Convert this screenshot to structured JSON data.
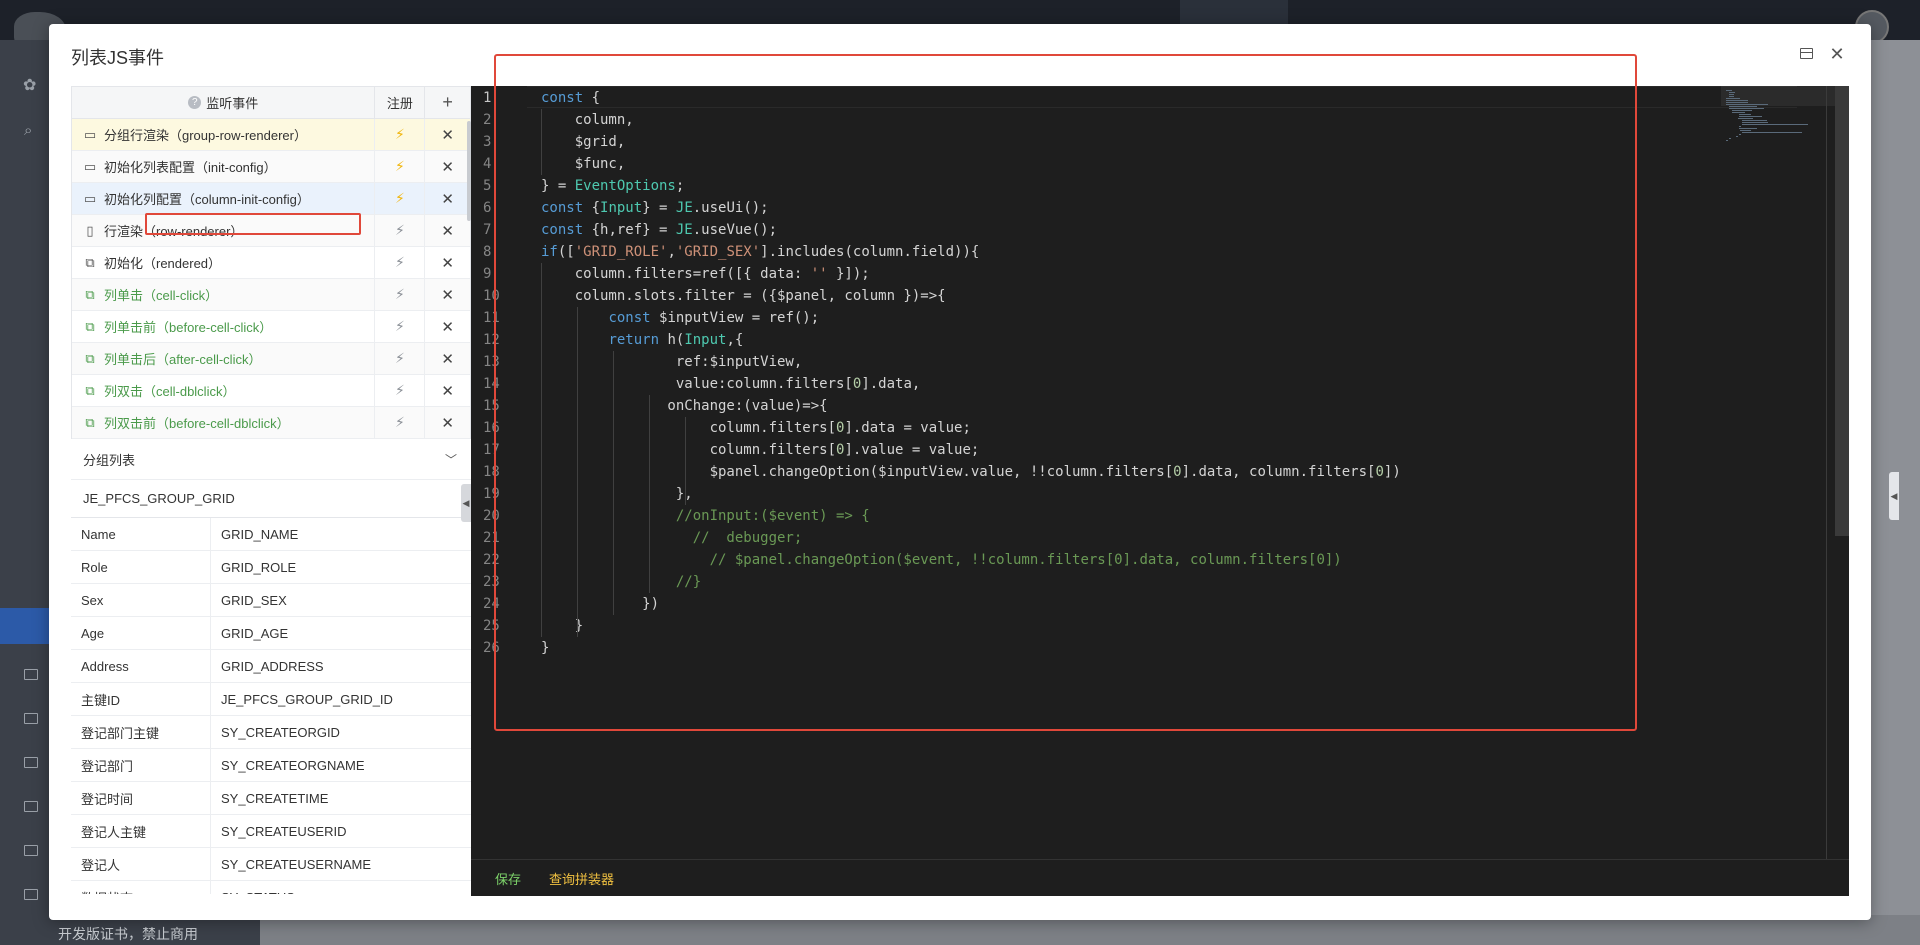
{
  "dialog": {
    "title": "列表JS事件"
  },
  "events": {
    "header": {
      "listen": "监听事件",
      "register": "注册",
      "add": "+"
    },
    "rows": [
      {
        "label": "分组行渲染（group-row-renderer）",
        "icon": "laptop-icon",
        "green": false,
        "registered": true
      },
      {
        "label": "初始化列表配置（init-config）",
        "icon": "laptop-icon",
        "green": false,
        "registered": true
      },
      {
        "label": "初始化列配置（column-init-config）",
        "icon": "laptop-icon",
        "green": false,
        "registered": true
      },
      {
        "label": "行渲染（row-renderer）",
        "icon": "mobile-icon",
        "green": false,
        "registered": false
      },
      {
        "label": "初始化（rendered）",
        "icon": "devices-icon",
        "green": false,
        "registered": false
      },
      {
        "label": "列单击（cell-click）",
        "icon": "devices-icon",
        "green": true,
        "registered": false
      },
      {
        "label": "列单击前（before-cell-click）",
        "icon": "devices-icon",
        "green": true,
        "registered": false
      },
      {
        "label": "列单击后（after-cell-click）",
        "icon": "devices-icon",
        "green": true,
        "registered": false
      },
      {
        "label": "列双击（cell-dblclick）",
        "icon": "devices-icon",
        "green": true,
        "registered": false
      },
      {
        "label": "列双击前（before-cell-dblclick）",
        "icon": "devices-icon",
        "green": true,
        "registered": false
      }
    ]
  },
  "group": {
    "title": "分组列表",
    "code": "JE_PFCS_GROUP_GRID",
    "fields": [
      {
        "name": "Name",
        "code": "GRID_NAME"
      },
      {
        "name": "Role",
        "code": "GRID_ROLE"
      },
      {
        "name": "Sex",
        "code": "GRID_SEX"
      },
      {
        "name": "Age",
        "code": "GRID_AGE"
      },
      {
        "name": "Address",
        "code": "GRID_ADDRESS"
      },
      {
        "name": "主键ID",
        "code": "JE_PFCS_GROUP_GRID_ID"
      },
      {
        "name": "登记部门主键",
        "code": "SY_CREATEORGID"
      },
      {
        "name": "登记部门",
        "code": "SY_CREATEORGNAME"
      },
      {
        "name": "登记时间",
        "code": "SY_CREATETIME"
      },
      {
        "name": "登记人主键",
        "code": "SY_CREATEUSERID"
      },
      {
        "name": "登记人",
        "code": "SY_CREATEUSERNAME"
      },
      {
        "name": "数据状态",
        "code": "SY_STATUS"
      }
    ]
  },
  "editor": {
    "lines": [
      [
        [
          "kw",
          "const"
        ],
        [
          "p",
          " {"
        ]
      ],
      [
        [
          "p",
          "    column,"
        ]
      ],
      [
        [
          "p",
          "    $grid,"
        ]
      ],
      [
        [
          "p",
          "    $func,"
        ]
      ],
      [
        [
          "p",
          "} = "
        ],
        [
          "cls",
          "EventOptions"
        ],
        [
          "p",
          ";"
        ]
      ],
      [
        [
          "kw",
          "const"
        ],
        [
          "p",
          " {"
        ],
        [
          "cls",
          "Input"
        ],
        [
          "p",
          "} = "
        ],
        [
          "cls",
          "JE"
        ],
        [
          "p",
          ".useUi();"
        ]
      ],
      [
        [
          "kw",
          "const"
        ],
        [
          "p",
          " {h,ref} = "
        ],
        [
          "cls",
          "JE"
        ],
        [
          "p",
          ".useVue();"
        ]
      ],
      [
        [
          "kw",
          "if"
        ],
        [
          "p",
          "(["
        ],
        [
          "str",
          "'GRID_ROLE'"
        ],
        [
          "p",
          ","
        ],
        [
          "str",
          "'GRID_SEX'"
        ],
        [
          "p",
          "].includes(column.field)){"
        ]
      ],
      [
        [
          "p",
          "    column.filters=ref([{ data: "
        ],
        [
          "str",
          "''"
        ],
        [
          "p",
          " }]);"
        ]
      ],
      [
        [
          "p",
          "    column.slots.filter = ({$panel, column })=>{"
        ]
      ],
      [
        [
          "p",
          "        "
        ],
        [
          "kw",
          "const"
        ],
        [
          "p",
          " $inputView = ref();"
        ]
      ],
      [
        [
          "p",
          "        "
        ],
        [
          "kw",
          "return"
        ],
        [
          "p",
          " h("
        ],
        [
          "cls",
          "Input"
        ],
        [
          "p",
          ",{"
        ]
      ],
      [
        [
          "p",
          "                ref:$inputView,"
        ]
      ],
      [
        [
          "p",
          "                value:column.filters["
        ],
        [
          "num",
          "0"
        ],
        [
          "p",
          "].data,"
        ]
      ],
      [
        [
          "p",
          "               onChange:(value)=>{"
        ]
      ],
      [
        [
          "p",
          "                    column.filters["
        ],
        [
          "num",
          "0"
        ],
        [
          "p",
          "].data = value;"
        ]
      ],
      [
        [
          "p",
          "                    column.filters["
        ],
        [
          "num",
          "0"
        ],
        [
          "p",
          "].value = value;"
        ]
      ],
      [
        [
          "p",
          "                    $panel.changeOption($inputView.value, !!column.filters["
        ],
        [
          "num",
          "0"
        ],
        [
          "p",
          "].data, column.filters["
        ],
        [
          "num",
          "0"
        ],
        [
          "p",
          "])"
        ]
      ],
      [
        [
          "p",
          "                },"
        ]
      ],
      [
        [
          "cm",
          "                //onInput:($event) => {"
        ]
      ],
      [
        [
          "cm",
          "                  //  debugger;"
        ]
      ],
      [
        [
          "cm",
          "                    // $panel.changeOption($event, !!column.filters[0].data, column.filters[0])"
        ]
      ],
      [
        [
          "cm",
          "                //}"
        ]
      ],
      [
        [
          "p",
          "            })"
        ]
      ],
      [
        [
          "p",
          "    }"
        ]
      ],
      [
        [
          "p",
          "}"
        ]
      ]
    ],
    "save_label": "保存",
    "query_label": "查询拼装器"
  },
  "background": {
    "watermark": "开发版证书，禁止商用"
  }
}
